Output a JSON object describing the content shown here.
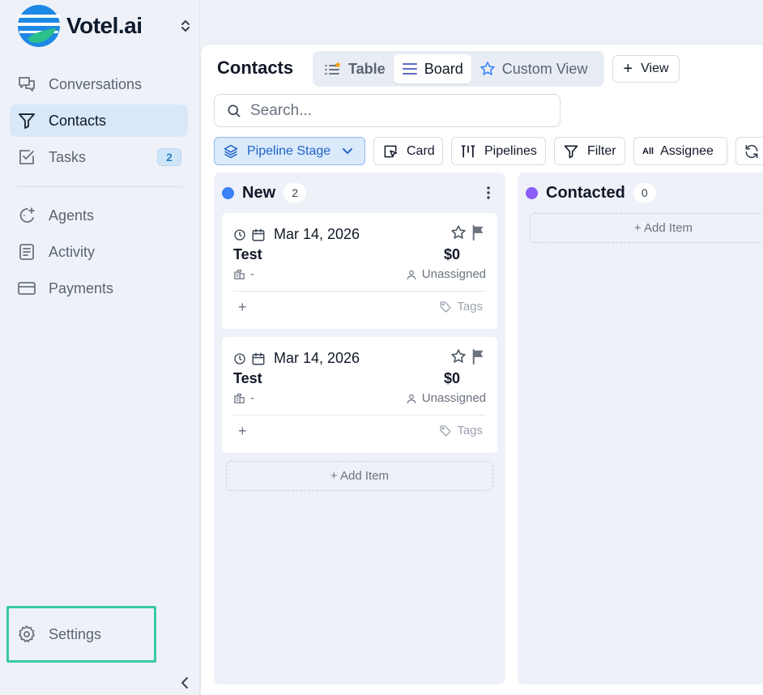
{
  "brand": {
    "name": "Votel.ai",
    "accent": "#2783c7",
    "logo_blue": "#1e88e5",
    "logo_green": "#2bbf8a"
  },
  "sidebar": {
    "items": [
      {
        "label": "Conversations",
        "icon": "chat-icon"
      },
      {
        "label": "Contacts",
        "icon": "funnel-icon",
        "active": true
      },
      {
        "label": "Tasks",
        "icon": "checkbox-icon",
        "badge": "2"
      },
      {
        "label": "Agents",
        "icon": "agent-sparkle-icon"
      },
      {
        "label": "Activity",
        "icon": "document-icon"
      },
      {
        "label": "Payments",
        "icon": "credit-card-icon"
      }
    ],
    "settings_label": "Settings",
    "settings_highlight": "#3bc9a4"
  },
  "header": {
    "title": "Contacts",
    "views": [
      {
        "label": "Table",
        "icon": "list-icon"
      },
      {
        "label": "Board",
        "icon": "board-icon",
        "active": true
      },
      {
        "label": "Custom View",
        "icon": "star-icon"
      }
    ],
    "add_view_label": "View"
  },
  "search": {
    "placeholder": "Search..."
  },
  "toolbar": {
    "pipeline_stage": "Pipeline Stage",
    "card": "Card",
    "pipelines": "Pipelines",
    "filter": "Filter",
    "all_tag": "All",
    "assignee": "Assignee"
  },
  "board": {
    "columns": [
      {
        "title": "New",
        "count": "2",
        "color": "#3b82f6",
        "cards": [
          {
            "date": "Mar 14, 2026",
            "name": "Test",
            "amount": "$0",
            "company": "-",
            "assignee": "Unassigned",
            "tags": "Tags",
            "add": "+"
          },
          {
            "date": "Mar 14, 2026",
            "name": "Test",
            "amount": "$0",
            "company": "-",
            "assignee": "Unassigned",
            "tags": "Tags",
            "add": "+"
          }
        ],
        "add_item": "+ Add Item"
      },
      {
        "title": "Contacted",
        "count": "0",
        "color": "#8b5cf6",
        "cards": [],
        "add_item": "+ Add Item"
      }
    ]
  }
}
